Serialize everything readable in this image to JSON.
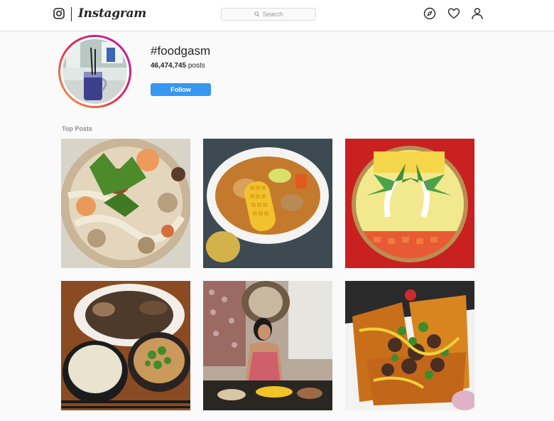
{
  "header": {
    "brand": "Instagram",
    "search_placeholder": "Search",
    "nav_icons": [
      "explore-icon",
      "heart-icon",
      "profile-icon"
    ]
  },
  "hashtag": {
    "title": "#foodgasm",
    "post_count": "46,474,745",
    "post_count_suffix": "posts",
    "follow_label": "Follow"
  },
  "sections": {
    "top_posts_label": "Top Posts"
  },
  "colors": {
    "follow_blue": "#3897f0",
    "border": "#dbdbdb",
    "background": "#fafafa",
    "ring_start": "#f9a13a",
    "ring_end": "#b51bb0"
  },
  "posts": [
    {
      "subject": "noodle-soup-with-shrimp"
    },
    {
      "subject": "corn-stew-bowl"
    },
    {
      "subject": "palm-tree-mosaic-plate"
    },
    {
      "subject": "rice-and-beef-meal"
    },
    {
      "subject": "woman-at-dinner-table"
    },
    {
      "subject": "plantain-beef-dish"
    }
  ]
}
